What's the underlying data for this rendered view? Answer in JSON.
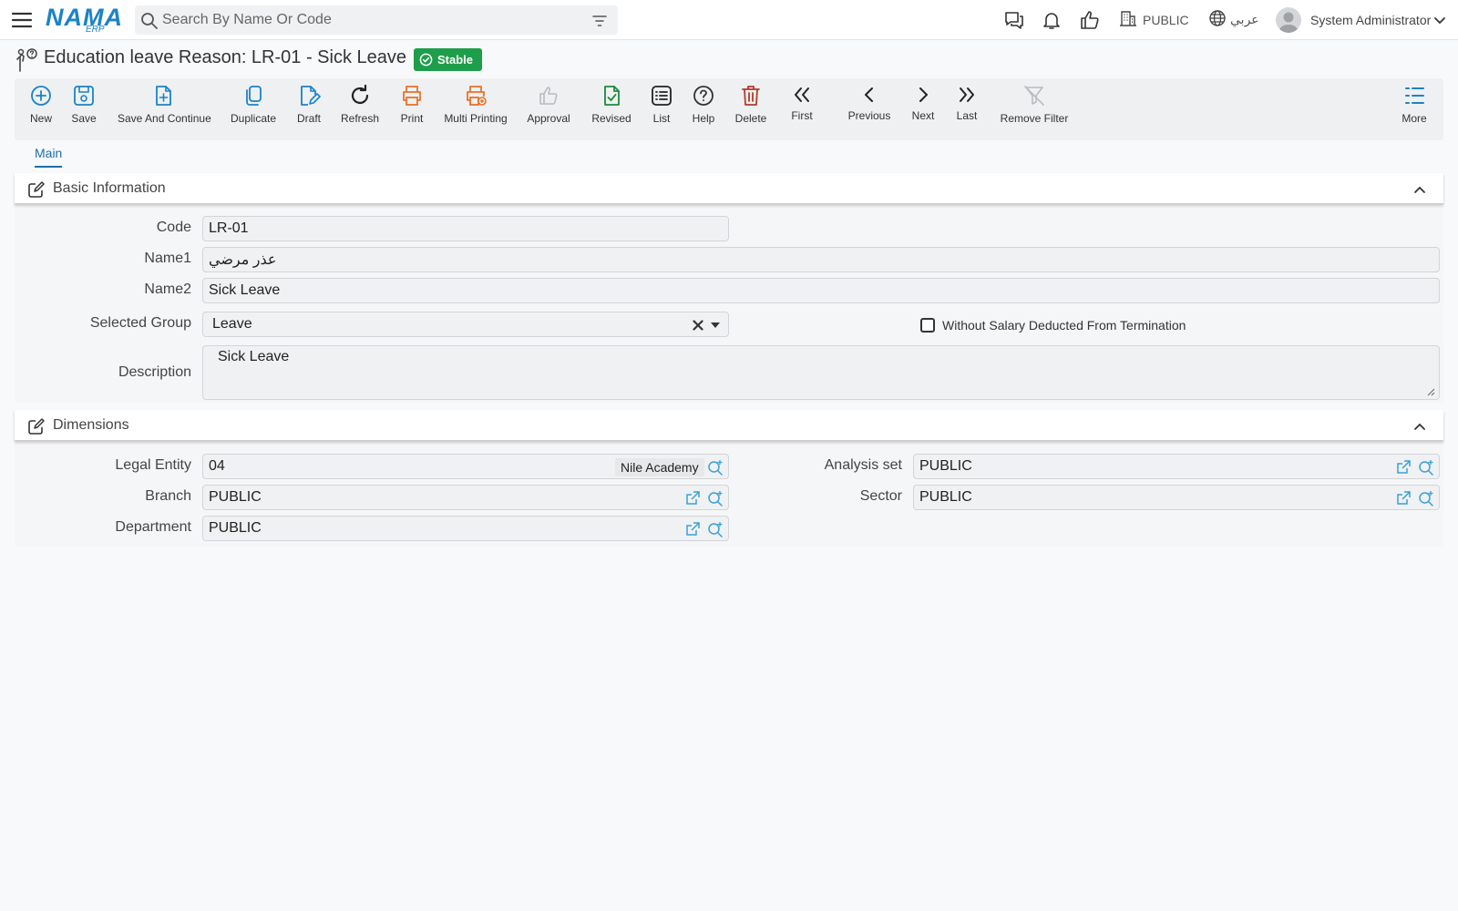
{
  "topbar": {
    "logo_text": "NAMA",
    "logo_sub": "ERP",
    "search_placeholder": "Search By Name Or Code",
    "company": "PUBLIC",
    "language": "عربي",
    "user_name": "System Administrator"
  },
  "page": {
    "title": "Education leave Reason: LR-01 - Sick Leave",
    "status": "Stable",
    "status_color": "#1e9e4a"
  },
  "toolbar": {
    "new": "New",
    "save": "Save",
    "save_continue": "Save And Continue",
    "duplicate": "Duplicate",
    "draft": "Draft",
    "refresh": "Refresh",
    "print": "Print",
    "multi_printing": "Multi Printing",
    "approval": "Approval",
    "revised": "Revised",
    "list": "List",
    "help": "Help",
    "delete": "Delete",
    "first": "First",
    "previous": "Previous",
    "next": "Next",
    "last": "Last",
    "remove_filter": "Remove Filter",
    "more": "More"
  },
  "tabs": {
    "main": "Main"
  },
  "basic_info": {
    "title": "Basic Information",
    "code_label": "Code",
    "code_value": "LR-01",
    "name1_label": "Name1",
    "name1_value": "عذر مرضي",
    "name2_label": "Name2",
    "name2_value": "Sick Leave",
    "group_label": "Selected Group",
    "group_value": "Leave",
    "checkbox_label": "Without Salary Deducted From Termination",
    "checkbox_checked": false,
    "description_label": "Description",
    "description_value": "Sick Leave"
  },
  "dimensions": {
    "title": "Dimensions",
    "legal_entity_label": "Legal Entity",
    "legal_entity_value": "04",
    "legal_entity_tag": "Nile Academy",
    "branch_label": "Branch",
    "branch_value": "PUBLIC",
    "department_label": "Department",
    "department_value": "PUBLIC",
    "analysis_set_label": "Analysis set",
    "analysis_set_value": "PUBLIC",
    "sector_label": "Sector",
    "sector_value": "PUBLIC"
  },
  "colors": {
    "primary": "#1b83c6",
    "print_orange": "#e8722c",
    "delete_red": "#b23a2b",
    "revised_green": "#1e8a3c"
  }
}
